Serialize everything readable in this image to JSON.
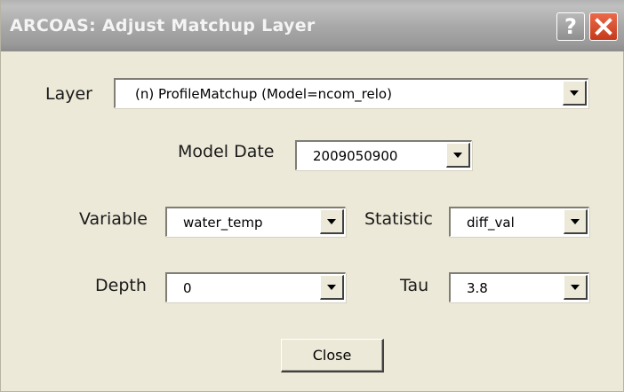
{
  "window": {
    "title": "ARCOAS:  Adjust Matchup Layer",
    "help_icon": "help-icon",
    "close_icon": "close-icon",
    "accent_color": "#d44a2a"
  },
  "form": {
    "layer": {
      "label": "Layer",
      "value": "(n) ProfileMatchup (Model=ncom_relo)"
    },
    "model_date": {
      "label": "Model Date",
      "value": "2009050900"
    },
    "variable": {
      "label": "Variable",
      "value": "water_temp"
    },
    "statistic": {
      "label": "Statistic",
      "value": "diff_val"
    },
    "depth": {
      "label": "Depth",
      "value": "0"
    },
    "tau": {
      "label": "Tau",
      "value": "3.8"
    }
  },
  "buttons": {
    "close_label": "Close"
  }
}
